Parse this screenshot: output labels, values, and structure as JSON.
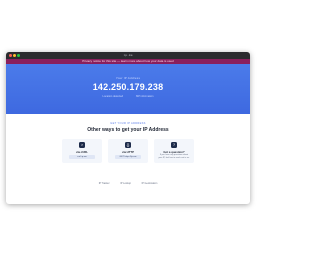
{
  "browser": {
    "url": "ip.me"
  },
  "banner": {
    "text": "Privacy notice for this site — learn more about how your data is used"
  },
  "hero": {
    "label": "Your IP Address",
    "ip": "142.250.179.238",
    "sub_left": "Location detected",
    "sub_right": "ISP information"
  },
  "section": {
    "eyebrow": "GET YOUR IP ADDRESS",
    "heading": "Other ways to get your IP Address"
  },
  "cards": [
    {
      "icon": "terminal-icon",
      "glyph": ">",
      "title": "via cURL",
      "button": "curl ip.me"
    },
    {
      "icon": "code-icon",
      "glyph": "{}",
      "title": "via HTTP",
      "button": "GET https://ip.me"
    },
    {
      "icon": "question-icon",
      "glyph": "?",
      "title": "Got a question?",
      "text": "If you have any questions about your IP, feel free to reach out to us."
    }
  ],
  "footer": {
    "links": [
      "IP Tracker",
      "IP Lookup",
      "IP Geolocation"
    ]
  },
  "colors": {
    "hero": "#4b7bea",
    "banner": "#8a1f5c",
    "card_bg": "#f3f6fb",
    "icon_bg": "#1d2b4a"
  }
}
